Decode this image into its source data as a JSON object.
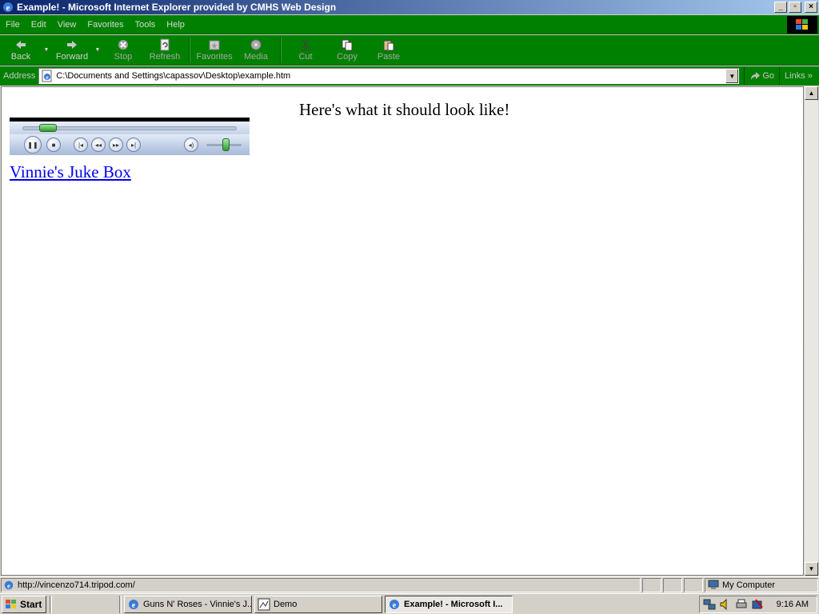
{
  "window": {
    "title": "Example! - Microsoft Internet Explorer provided by CMHS Web Design",
    "controls": [
      "_",
      "▫",
      "×"
    ]
  },
  "menu": [
    "File",
    "Edit",
    "View",
    "Favorites",
    "Tools",
    "Help"
  ],
  "toolbar": {
    "back": "Back",
    "forward": "Forward",
    "stop": "Stop",
    "refresh": "Refresh",
    "favorites": "Favorites",
    "media": "Media",
    "cut": "Cut",
    "copy": "Copy",
    "paste": "Paste"
  },
  "address": {
    "label": "Address",
    "url": "C:\\Documents and Settings\\capassov\\Desktop\\example.htm",
    "go": "Go",
    "links": "Links"
  },
  "page": {
    "heading": "Here's what it should look like!",
    "link": "Vinnie's Juke Box",
    "player": {
      "seek_fraction": 0.12,
      "volume_fraction": 0.55
    }
  },
  "status": {
    "url": "http://vincenzo714.tripod.com/",
    "zone": "My Computer"
  },
  "taskbar": {
    "start": "Start",
    "tasks": [
      {
        "label": "Guns N' Roses - Vinnie's J...",
        "active": false
      },
      {
        "label": "Demo",
        "active": false
      },
      {
        "label": "Example! - Microsoft I...",
        "active": true
      }
    ],
    "clock": "9:16 AM"
  },
  "colors": {
    "chrome_green": "#008000",
    "title_blue": "#0a246a",
    "link_blue": "#0000ee"
  }
}
